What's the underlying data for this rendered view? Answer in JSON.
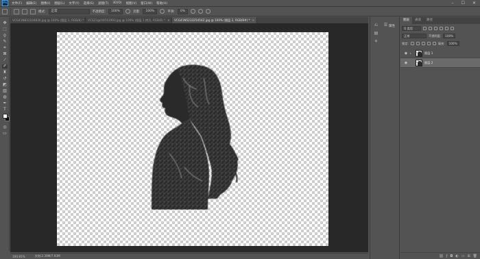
{
  "menubar": {
    "logo": "Ps",
    "items": [
      "文件(F)",
      "编辑(E)",
      "图像(I)",
      "图层(L)",
      "文字(Y)",
      "选择(S)",
      "滤镜(T)",
      "3D(D)",
      "视图(V)",
      "窗口(W)",
      "帮助(H)"
    ],
    "window_controls": [
      "–",
      "☐",
      "✕"
    ]
  },
  "options": {
    "mode_label": "模式:",
    "mode_value": "正常",
    "opacity_label": "不透明度:",
    "opacity_value": "100%",
    "flow_label": "流量:",
    "flow_value": "100%",
    "smooth_label": "平滑:",
    "smooth_value": "0%"
  },
  "tabs": [
    "VCG41N831104830.jpg @ 100% (图层 1, RGB/8) *",
    "VCG21gch9741993.jpg @ 100% (图层 1 拷贝, RGB/8) *",
    "VCG41N523325454Z.jpg @ 100% (图层 2, RGB/8#) *"
  ],
  "statusbar": {
    "zoom": "100.81%",
    "doc_info": "文档:2.39M/7.93M"
  },
  "strip": {
    "label": "属性"
  },
  "panel": {
    "tabs": [
      "图层",
      "通道",
      "路径"
    ],
    "filter_label": "Q 类型",
    "blend_mode": "正常",
    "opacity_label": "不透明度:",
    "opacity_value": "100%",
    "lock_label": "锁定:",
    "fill_label": "填充:",
    "fill_value": "100%",
    "layers": [
      {
        "name": "图层 1",
        "selected": false
      },
      {
        "name": "图层 2",
        "selected": true
      }
    ]
  },
  "icons": {
    "eye": "visibility-eye-icon",
    "link": "layer-link-icon"
  },
  "colors": {
    "foreground": "#ffffff",
    "background": "#000000",
    "accent": "#31a8ff"
  }
}
